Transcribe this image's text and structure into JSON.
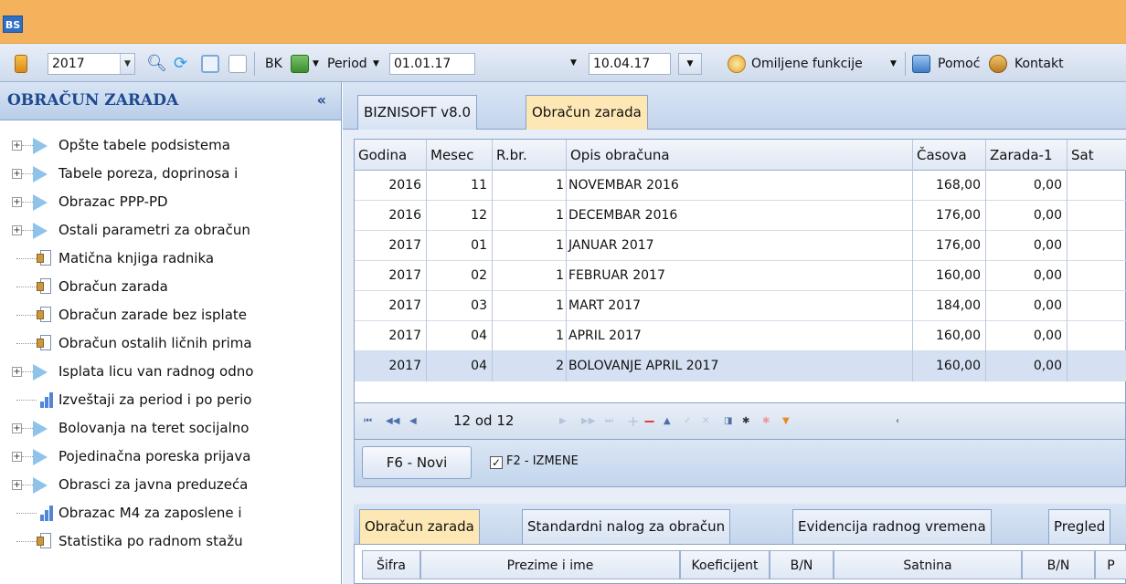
{
  "app": {
    "logo": "BS"
  },
  "toolbar": {
    "year": "2017",
    "bk": "BK",
    "period_label": "Period",
    "date_from": "01.01.17",
    "date_to": "10.04.17",
    "favorites": "Omiljene funkcije",
    "help": "Pomoć",
    "contact": "Kontakt"
  },
  "sidebar": {
    "title": "OBRAČUN ZARADA",
    "collapse": "«",
    "items": [
      {
        "label": "Opšte tabele podsistema",
        "icon": "folder-arrow"
      },
      {
        "label": "Tabele poreza, doprinosa i",
        "icon": "folder-arrow"
      },
      {
        "label": "Obrazac PPP-PD",
        "icon": "folder-arrow"
      },
      {
        "label": "Ostali parametri za obračun",
        "icon": "folder-arrow"
      },
      {
        "label": "Matična knjiga radnika",
        "icon": "document"
      },
      {
        "label": "Obračun zarada",
        "icon": "document"
      },
      {
        "label": "Obračun zarade bez isplate",
        "icon": "document"
      },
      {
        "label": "Obračun ostalih ličnih prima",
        "icon": "document"
      },
      {
        "label": "Isplata licu van radnog odno",
        "icon": "folder-arrow"
      },
      {
        "label": "Izveštaji za period i po perio",
        "icon": "report"
      },
      {
        "label": "Bolovanja na teret socijalno",
        "icon": "folder-arrow"
      },
      {
        "label": "Pojedinačna poreska prijava",
        "icon": "folder-arrow"
      },
      {
        "label": "Obrasci za javna preduzeća",
        "icon": "folder-arrow"
      },
      {
        "label": "Obrazac M4 za zaposlene i",
        "icon": "report"
      },
      {
        "label": "Statistika po radnom stažu",
        "icon": "document"
      }
    ]
  },
  "main": {
    "tabs": [
      {
        "label": "BIZNISOFT v8.0"
      },
      {
        "label": "Obračun zarada"
      }
    ],
    "grid": {
      "columns": [
        "Godina",
        "Mesec",
        "R.br.",
        "Opis obračuna",
        "Časova",
        "Zarada-1",
        "Sat"
      ],
      "rows": [
        [
          "2016",
          "11",
          "1",
          "NOVEMBAR 2016",
          "168,00",
          "0,00"
        ],
        [
          "2016",
          "12",
          "1",
          "DECEMBAR 2016",
          "176,00",
          "0,00"
        ],
        [
          "2017",
          "01",
          "1",
          "JANUAR 2017",
          "176,00",
          "0,00"
        ],
        [
          "2017",
          "02",
          "1",
          "FEBRUAR 2017",
          "160,00",
          "0,00"
        ],
        [
          "2017",
          "03",
          "1",
          "MART 2017",
          "184,00",
          "0,00"
        ],
        [
          "2017",
          "04",
          "1",
          "APRIL 2017",
          "160,00",
          "0,00"
        ],
        [
          "2017",
          "04",
          "2",
          "BOLOVANJE APRIL 2017",
          "160,00",
          "0,00"
        ]
      ]
    },
    "navigator": {
      "position": "12 od 12"
    },
    "new_button": "F6 - Novi",
    "edit_checkbox": "F2 - IZMENE",
    "subtabs": [
      {
        "label": "Obračun zarada"
      },
      {
        "label": "Standardni nalog za obračun"
      },
      {
        "label": "Evidencija radnog vremena"
      },
      {
        "label": "Pregled"
      }
    ],
    "subgrid_columns": [
      "Šifra",
      "Prezime i ime",
      "Koeficijent",
      "B/N",
      "Satnina",
      "B/N",
      "P"
    ]
  }
}
